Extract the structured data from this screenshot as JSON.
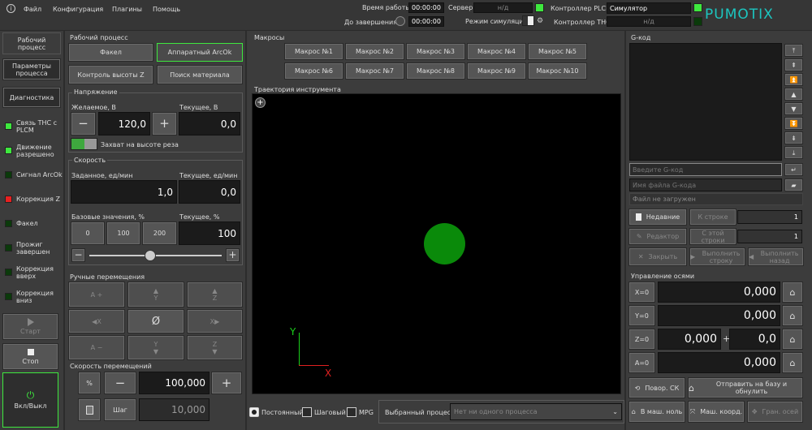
{
  "menu": {
    "file": "Файл",
    "config": "Конфигурация",
    "plugins": "Плагины",
    "help": "Помощь"
  },
  "top": {
    "run_time_label": "Время работы",
    "run_time": "00:00:00",
    "to_end_label": "До завершения",
    "to_end": "00:00:00",
    "server_label": "Сервер",
    "server_value": "н/д",
    "sim_label": "Режим симуляции",
    "plcm_label": "Контроллер PLCM",
    "plcm_value": "Симулятор",
    "thc_label": "Контроллер THC",
    "thc_value": "н/д",
    "logo": "PUMOTIX"
  },
  "left_tabs": {
    "work": "Рабочий процесс",
    "params": "Параметры процесса",
    "diag": "Диагностика"
  },
  "signals": [
    {
      "label": "Связь THC с PLCM",
      "color": "#3ee83e"
    },
    {
      "label": "Движение разрешено",
      "color": "#3ee83e"
    },
    {
      "label": "Сигнал ArcOk",
      "color": "#0b3a0b"
    },
    {
      "label": "Коррекция Z",
      "color": "#e82020"
    },
    {
      "label": "Факел",
      "color": "#0b3a0b"
    },
    {
      "label": "Прожиг завершен",
      "color": "#0b3a0b"
    },
    {
      "label": "Коррекция вверх",
      "color": "#0b3a0b"
    },
    {
      "label": "Коррекция вниз",
      "color": "#0b3a0b"
    }
  ],
  "control": {
    "start": "Старт",
    "stop": "Стоп",
    "power": "Вкл/Выкл"
  },
  "process": {
    "title": "Рабочий процесс",
    "torch": "Факел",
    "hw_arcok": "Аппаратный ArcOk",
    "height_ctrl": "Контроль высоты Z",
    "material_search": "Поиск материала"
  },
  "voltage": {
    "title": "Напряжение",
    "desired_label": "Желаемое, В",
    "current_label": "Текущее, В",
    "desired_value": "120,0",
    "current_value": "0,0",
    "capture_label": "Захват на высоте реза",
    "minus": "−",
    "plus": "+"
  },
  "speed": {
    "title": "Скорость",
    "set_label": "Заданное, ед/мин",
    "current_label": "Текущее, ед/мин",
    "set_value": "1,0",
    "current_value": "0,0",
    "base_label": "Базовые значения, %",
    "cur_pct_label": "Текущее, %",
    "presets": [
      "0",
      "100",
      "200"
    ],
    "current_pct": "100",
    "slider_fraction": 0.46,
    "minus": "−",
    "plus": "+"
  },
  "jog": {
    "title": "Ручные перемещения",
    "a_plus": "A +",
    "y_plus": "Y",
    "z_plus": "Z",
    "x_minus": "X",
    "zero": "Ø",
    "x_plus": "X",
    "a_minus": "A −",
    "y_minus": "Y",
    "z_minus": "Z",
    "speed_title": "Скорость перемещений",
    "pct": "%",
    "speed_value": "100,000",
    "step": "Шаг",
    "step_value": "10,000",
    "minus": "−",
    "plus": "+"
  },
  "macros": {
    "title": "Макросы",
    "items": [
      "Макрос №1",
      "Макрос №2",
      "Макрос №3",
      "Макрос №4",
      "Макрос №5",
      "Макрос №6",
      "Макрос №7",
      "Макрос №8",
      "Макрос №9",
      "Макрос №10"
    ]
  },
  "trajectory": {
    "title": "Траектория инструмента",
    "axis_y": "Y",
    "axis_x": "X",
    "tool_color": "#0a8a0a"
  },
  "mode": {
    "continuous": "Постоянный",
    "step": "Шаговый",
    "mpg": "MPG",
    "selected_process_label": "Выбранный процесс",
    "selected_process_value": "Нет ни одного процесса"
  },
  "gcode": {
    "title": "G-код",
    "input_placeholder": "Введите G-код",
    "file_placeholder": "Имя файла G-кода",
    "file_status": "Файл не загружен",
    "recent": "Недавние",
    "to_line": "К строке",
    "to_line_value": "1",
    "editor": "Редактор",
    "from_line": "С этой строки",
    "from_line_value": "1",
    "close": "Закрыть",
    "run_line": "Выполнить строку",
    "run_back": "Выполнить назад"
  },
  "axes": {
    "title": "Управление осями",
    "x_btn": "X=0",
    "y_btn": "Y=0",
    "z_btn": "Z=0",
    "a_btn": "A=0",
    "x_value": "0,000",
    "y_value": "0,000",
    "z_value": "0,000",
    "z_offset_sign": "+",
    "z_offset": "0,0",
    "a_value": "0,000",
    "rotate_cs": "Повор. СК",
    "home_zero": "Отправить на базу и обнулить",
    "to_machine_zero": "В маш. ноль",
    "machine_coords": "Маш. коорд.",
    "soft_limits": "Гран. осей"
  }
}
